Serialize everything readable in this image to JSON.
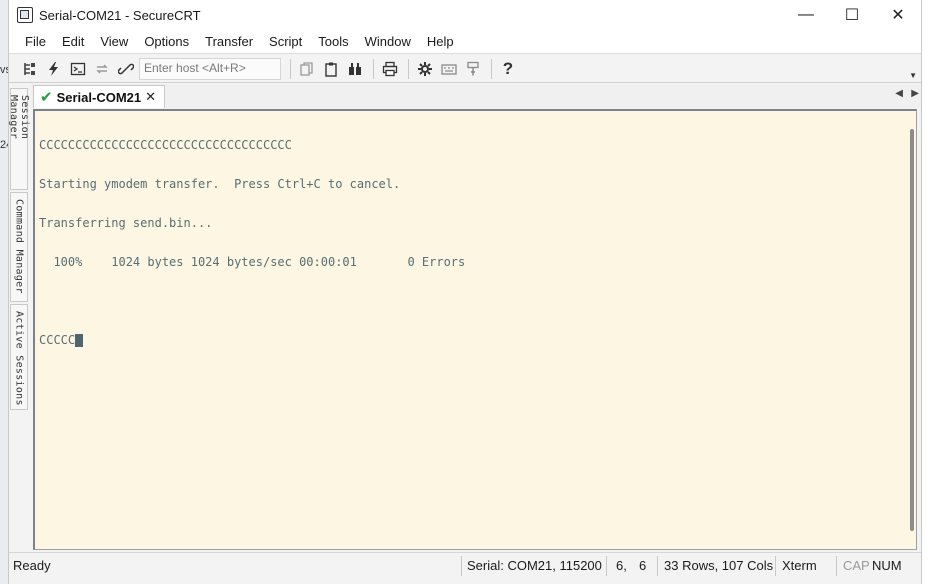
{
  "window": {
    "title": "Serial-COM21 - SecureCRT",
    "controls": {
      "minimize": "—",
      "maximize": "☐",
      "close": "✕"
    }
  },
  "menu": [
    "File",
    "Edit",
    "View",
    "Options",
    "Transfer",
    "Script",
    "Tools",
    "Window",
    "Help"
  ],
  "toolbar": {
    "host_placeholder": "Enter host <Alt+R>",
    "icons": [
      "connect-bar-icon",
      "quick-connect-icon",
      "connect-shell-icon",
      "reconnect-icon",
      "disconnect-icon",
      "copy-icon",
      "paste-icon",
      "find-icon",
      "print-icon",
      "options-icon",
      "keymap-icon",
      "sftp-icon",
      "help-icon"
    ]
  },
  "dock": {
    "session_manager": "Session Manager",
    "command_manager": "Command Manager",
    "active_sessions": "Active Sessions"
  },
  "tab": {
    "label": "Serial-COM21",
    "close": "✕"
  },
  "terminal": {
    "lines": [
      "CCCCCCCCCCCCCCCCCCCCCCCCCCCCCCCCCCC",
      "Starting ymodem transfer.  Press Ctrl+C to cancel.",
      "Transferring send.bin...",
      "  100%    1024 bytes 1024 bytes/sec 00:00:01       0 Errors",
      "",
      "CCCCC"
    ]
  },
  "status": {
    "ready": "Ready",
    "serial": "Serial: COM21, 115200",
    "row": "6,",
    "col": "6",
    "size": "33 Rows, 107 Cols",
    "term": "Xterm",
    "cap": "CAP",
    "num": "NUM"
  },
  "desktop_fragments": [
    "vs",
    "24"
  ]
}
